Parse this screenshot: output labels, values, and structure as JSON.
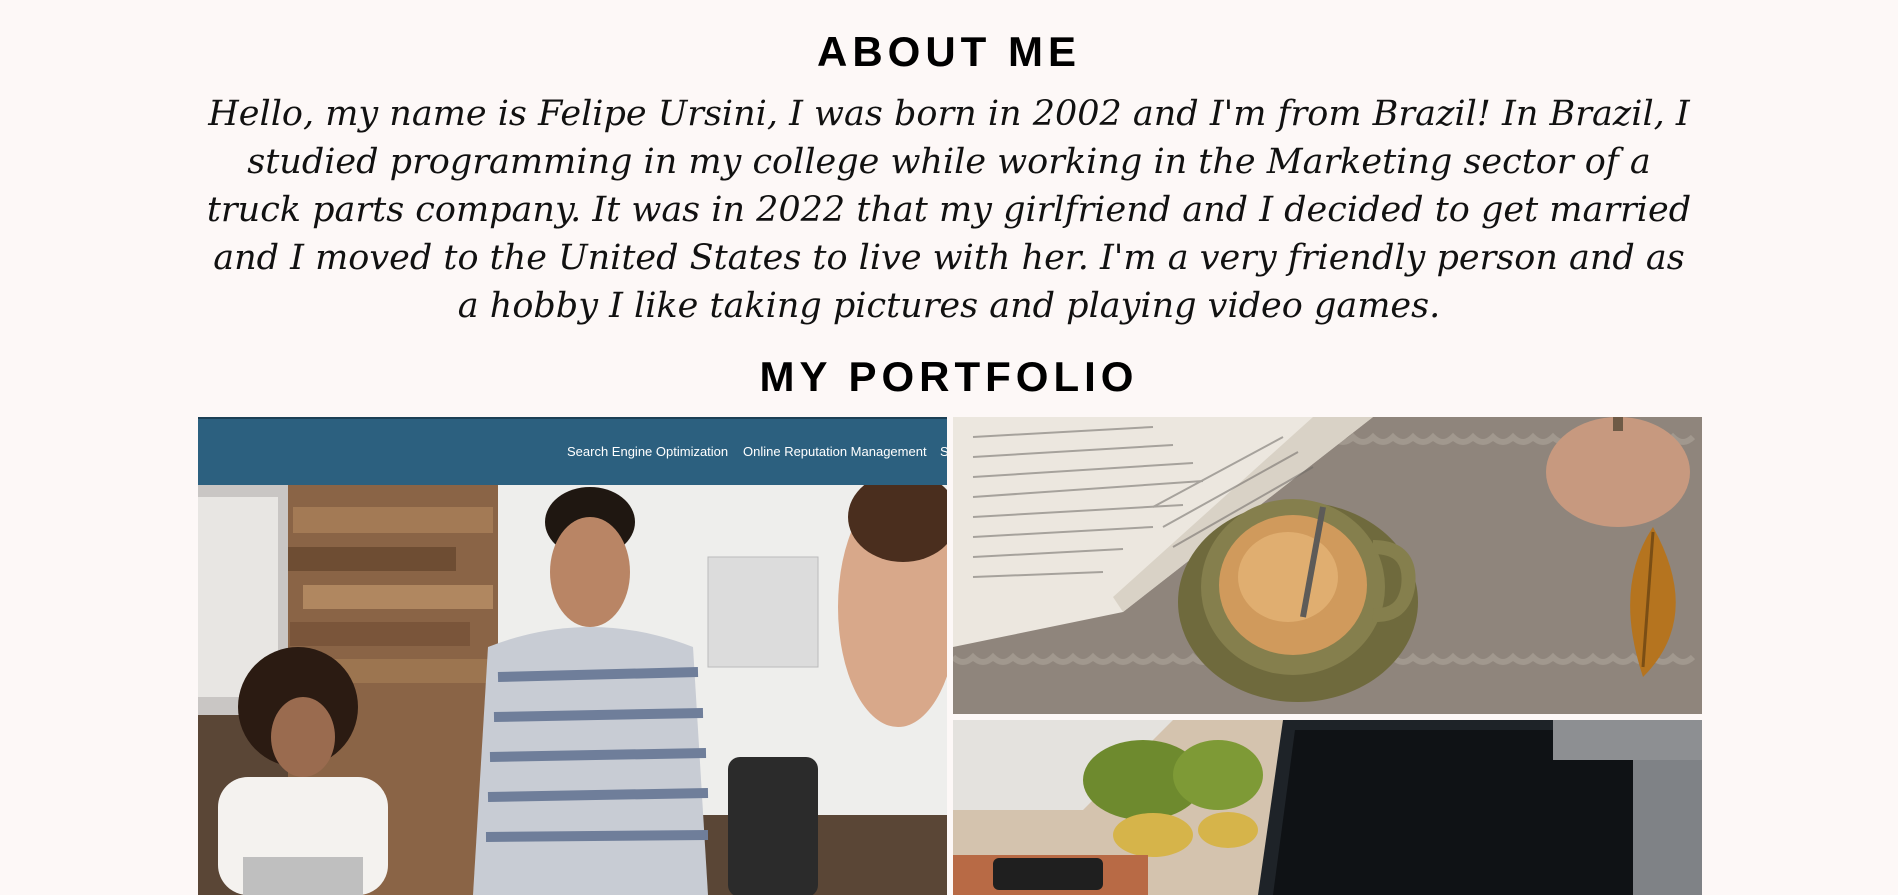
{
  "about": {
    "title": "ABOUT ME",
    "text": "Hello, my name is Felipe Ursini, I was born in 2002 and I'm from Brazil! In Brazil, I studied programming in my college while working in the Marketing sector of a truck parts company. It was in 2022 that my girlfriend and I decided to get married and I moved to the United States to live with her. I'm a very friendly person and as a hobby I like taking pictures and playing video games."
  },
  "portfolio": {
    "title": "MY PORTFOLIO",
    "projects": [
      {
        "image": "meeting-website-screenshot",
        "nav_items": [
          "Search Engine Optimization",
          "Online Reputation Management",
          "S"
        ]
      },
      {
        "image": "book-and-coffee-photo"
      },
      {
        "image": "desk-with-laptop-photo"
      }
    ]
  },
  "colors": {
    "background": "#fdf8f7",
    "navbar": "#2c607f",
    "heading": "#000000"
  }
}
